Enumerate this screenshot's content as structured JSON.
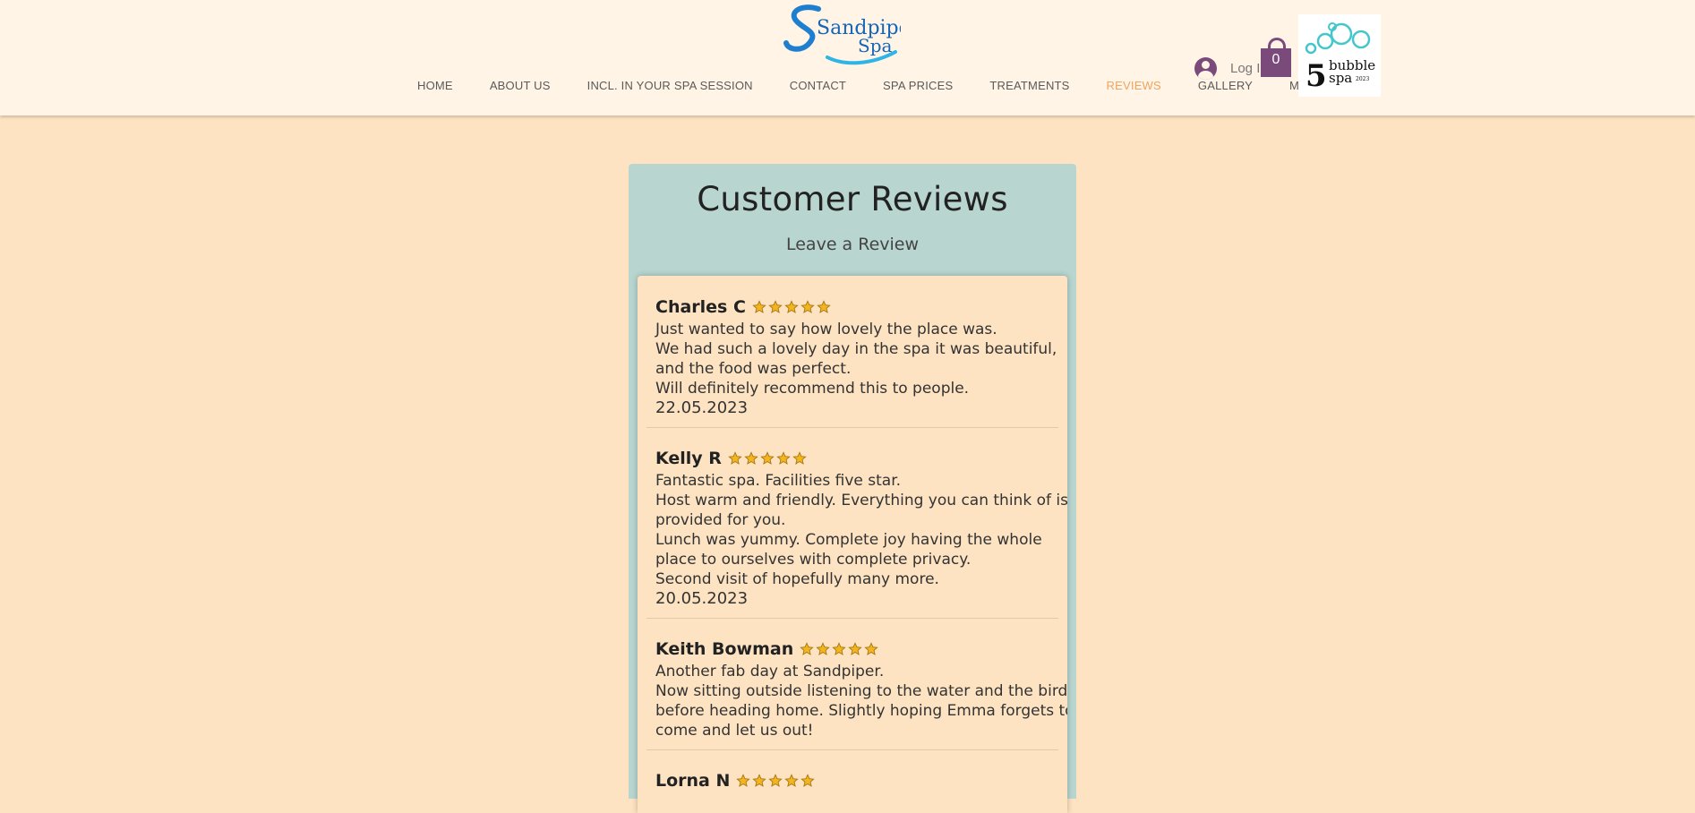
{
  "brand": {
    "logo_text_line1": "Sandpiper",
    "logo_text_line2": "Spa",
    "badge_number": "5",
    "badge_text_1": "bubble",
    "badge_text_2": "spa",
    "badge_year": "2023"
  },
  "nav": {
    "items": [
      {
        "label": "HOME"
      },
      {
        "label": "ABOUT US"
      },
      {
        "label": "INCL. IN YOUR SPA SESSION"
      },
      {
        "label": "CONTACT"
      },
      {
        "label": "SPA PRICES"
      },
      {
        "label": "TREATMENTS"
      },
      {
        "label": "REVIEWS"
      },
      {
        "label": "GALLERY"
      },
      {
        "label": "More"
      }
    ],
    "active": "REVIEWS"
  },
  "login": {
    "label": "Log I"
  },
  "cart": {
    "count": "0"
  },
  "panel": {
    "title": "Customer Reviews",
    "leave_review": "Leave a Review"
  },
  "reviews": [
    {
      "name": "Charles C",
      "stars": 5,
      "lines": [
        "Just wanted to say how lovely the place was.",
        "We had such a lovely day in the spa it was beautiful,",
        "and the food was perfect.",
        "Will definitely recommend this to people."
      ],
      "date": "22.05.2023"
    },
    {
      "name": "Kelly R",
      "stars": 5,
      "lines": [
        "Fantastic spa. Facilities five star.",
        "Host warm and friendly. Everything you can think of is",
        "provided for you.",
        "Lunch was yummy. Complete joy having the whole",
        "place to ourselves with complete privacy.",
        "Second visit of hopefully many more."
      ],
      "date": "20.05.2023"
    },
    {
      "name": "Keith Bowman",
      "stars": 5,
      "lines": [
        "Another fab day at Sandpiper.",
        "Now sitting outside listening to the water and the birds",
        "before heading home.  Slightly hoping Emma forgets to",
        "come and let us out!"
      ],
      "date": ""
    },
    {
      "name": "Lorna N",
      "stars": 5,
      "lines": [],
      "date": ""
    }
  ],
  "colors": {
    "page_bg": "#fde3c2",
    "header_bg": "#fff4e5",
    "panel_bg": "#b8d5cf",
    "accent_nav_active": "#f0a45e",
    "cart_purple": "#7a4a7a",
    "star_gold": "#f2b51d"
  }
}
